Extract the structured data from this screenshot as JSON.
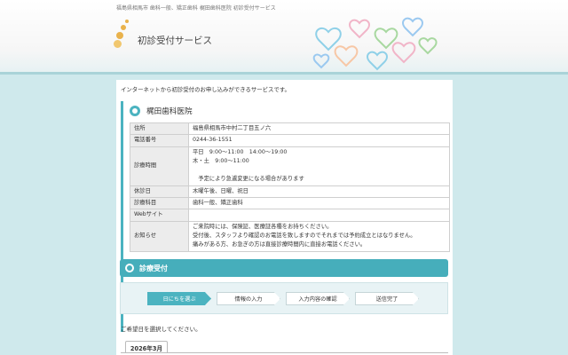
{
  "header": {
    "breadcrumb": "福島県相馬市 歯科一般、矯正歯科 梶田歯科医院 初診受付サービス",
    "service_title": "初診受付サービス",
    "logo_color": "#e9b24c"
  },
  "intro": "インターネットから初診受付のお申し込みができるサービスです。",
  "clinic": {
    "name": "梶田歯科医院",
    "rows": [
      {
        "label": "住所",
        "value": "福島県相馬市中村二丁目五ノ六"
      },
      {
        "label": "電話番号",
        "value": "0244-36-1551"
      },
      {
        "label": "診療時間",
        "value": "平日　9:00～11:00　14:00～19:00\n木・土　9:00～11:00\n\n　予定により急遽変更になる場合があります"
      },
      {
        "label": "休診日",
        "value": "木曜午後、日曜、祝日"
      },
      {
        "label": "診療科目",
        "value": "歯科一般、矯正歯科"
      },
      {
        "label": "Webサイト",
        "value": ""
      },
      {
        "label": "お知らせ",
        "value": "ご来院時には、保険証、医療証各種をお持ちください。\n受付後、スタッフより確認のお電話を致しますのでそれまでは予約成立とはなりません。\n痛みがある方、お急ぎの方は直接診療時間内に直接お電話ください。"
      }
    ]
  },
  "section": {
    "title": "診療受付"
  },
  "steps": [
    {
      "label": "日にちを選ぶ",
      "active": true
    },
    {
      "label": "情報の入力",
      "active": false
    },
    {
      "label": "入力内容の確認",
      "active": false
    },
    {
      "label": "送信完了",
      "active": false
    }
  ],
  "prompt": "ご希望日を選択してください。",
  "calendar": {
    "month_label": "2026年3月"
  },
  "colors": {
    "accent": "#4bb3c0",
    "background": "#cfe9ec"
  }
}
